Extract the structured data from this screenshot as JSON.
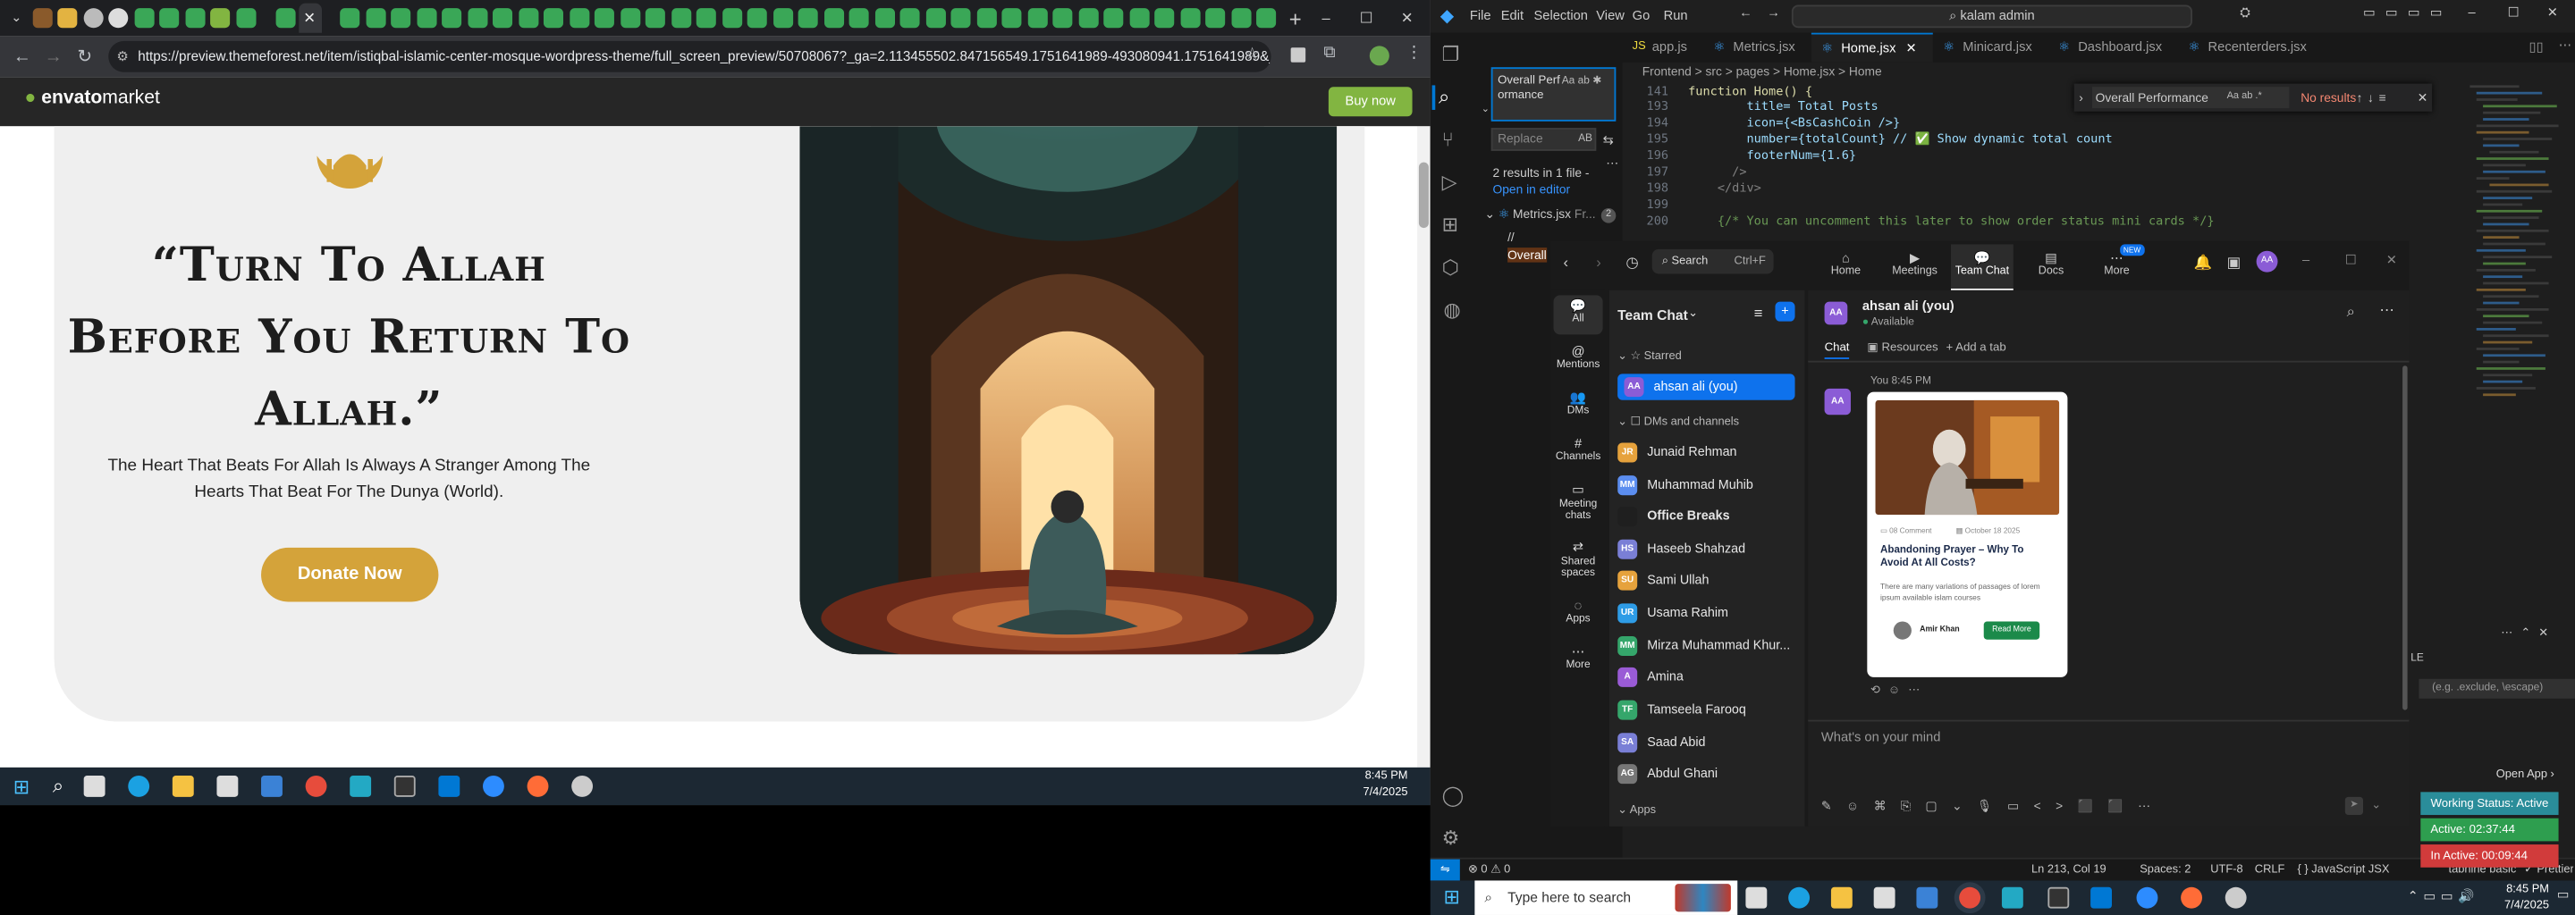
{
  "chrome": {
    "url": "https://preview.themeforest.net/item/istiqbal-islamic-center-mosque-wordpress-theme/full_screen_preview/50708067?_ga=2.113455502.847156549.1751641989-493080941.1751641989&_gac=1.6...",
    "url_host": "preview.themeforest.net",
    "new_tab": "+",
    "window_controls": {
      "minimize": "–",
      "maximize": "☐",
      "close": "✕"
    }
  },
  "envato": {
    "logo": "envato",
    "logo_suffix": "market",
    "buy_now": "Buy now"
  },
  "hero": {
    "quote": "“Turn To Allah Before You Return To Allah.”",
    "subtitle": "The Heart That Beats For Allah Is Always A Stranger Among The Hearts That Beat For The Dunya (World).",
    "donate": "Donate Now"
  },
  "taskbar_left": {
    "time": "8:45 PM",
    "date": "7/4/2025"
  },
  "vscode": {
    "menu": [
      "File",
      "Edit",
      "Selection",
      "View",
      "Go",
      "Run"
    ],
    "search_box": "kalam admin",
    "search": {
      "query": "Overall Performance",
      "replace": "Replace",
      "replace_all": "AB",
      "results": "2 results in 1 file -",
      "open_in_editor": "Open in editor",
      "file": "Metrics.jsx",
      "file_path": "Fr...",
      "file_count": "2",
      "match1": "//",
      "match2": "Overall"
    },
    "tabs": [
      "app.js",
      "Metrics.jsx",
      "Home.jsx",
      "Minicard.jsx",
      "Dashboard.jsx",
      "Recenterders.jsx"
    ],
    "active_tab": "Home.jsx",
    "breadcrumb": "Frontend  >  src  >  pages  >  Home.jsx  >  Home",
    "find": {
      "query": "Overall Performance",
      "result": "No results",
      "options": "Aa ab .*"
    },
    "code": [
      {
        "n": "193",
        "t": "        title= Total Posts"
      },
      {
        "n": "194",
        "t": "        icon={<BsCashCoin />}"
      },
      {
        "n": "195",
        "t": "        number={totalCount} // ✅ Show dynamic total count"
      },
      {
        "n": "196",
        "t": "        footerNum={1.6}"
      },
      {
        "n": "197",
        "t": "      />"
      },
      {
        "n": "198",
        "t": "    </div>"
      },
      {
        "n": "199",
        "t": ""
      },
      {
        "n": "200",
        "t": "    {/* You can uncomment this later to show order status mini cards */}"
      }
    ],
    "sticky_line": {
      "n": "141",
      "t": "function Home() {"
    },
    "status": {
      "errors": "⊗ 0  ⚠ 0",
      "position": "Ln 213, Col 19",
      "spaces": "Spaces: 2",
      "encoding": "UTF-8",
      "eol": "CRLF",
      "lang": "{ } JavaScript JSX",
      "tabnine": "tabnine basic",
      "prettier": "✓ Prettier"
    },
    "panel_hint": "LE",
    "panel_input": "(e.g. .exclude, \\escape)"
  },
  "zoom": {
    "search": "Search",
    "shortcut": "Ctrl+F",
    "nav": [
      "Home",
      "Meetings",
      "Team Chat",
      "Docs",
      "More"
    ],
    "new_badge": "NEW",
    "rail": [
      "All",
      "Mentions",
      "DMs",
      "Channels",
      "Meeting chats",
      "Shared spaces",
      "Apps",
      "More"
    ],
    "list_title": "Team Chat",
    "starred": "Starred",
    "self": "ahsan ali (you)",
    "dms_header": "DMs and channels",
    "contacts": [
      {
        "name": "Junaid Rehman",
        "initials": "JR",
        "color": "#e6a23c"
      },
      {
        "name": "Muhammad Muhib",
        "initials": "MM",
        "color": "#5b8def"
      },
      {
        "name": "Office Breaks",
        "initials": "",
        "color": "#1f1f1f"
      },
      {
        "name": "Haseeb Shahzad",
        "initials": "HS",
        "color": "#7a7fd6"
      },
      {
        "name": "Sami Ullah",
        "initials": "SU",
        "color": "#e6a23c"
      },
      {
        "name": "Usama Rahim",
        "initials": "UR",
        "color": "#2e9ce6"
      },
      {
        "name": "Mirza Muhammad Khur...",
        "initials": "MM",
        "color": "#35a66b"
      },
      {
        "name": "Amina",
        "initials": "A",
        "color": "#9a5bd6"
      },
      {
        "name": "Tamseela Farooq",
        "initials": "TF",
        "color": "#35a66b"
      },
      {
        "name": "Saad Abid",
        "initials": "SA",
        "color": "#7a7fd6"
      },
      {
        "name": "Abdul Ghani",
        "initials": "AG",
        "color": "#777777"
      }
    ],
    "apps": "Apps",
    "chat_user": "ahsan ali (you)",
    "chat_status": "Available",
    "chat_tabs": [
      "Chat",
      "Resources",
      "+ Add a tab"
    ],
    "msg_meta": "You 8:45 PM",
    "msg_avatar": "AA",
    "card": {
      "meta1": "08 Comment",
      "meta2": "October 18 2025",
      "title": "Abandoning Prayer – Why To Avoid At All Costs?",
      "body": "There are many variations of passages of lorem ipsum available islam courses",
      "author": "Amir Khan",
      "read_more": "Read More"
    },
    "composer": "What's on your mind"
  },
  "right_widgets": {
    "open_app": "Open App ›",
    "working": "Working Status: Active",
    "active": "Active: 02:37:44",
    "inactive": "In Active: 00:09:44"
  },
  "taskbar_right": {
    "search": "Type here to search",
    "time": "8:45 PM",
    "date": "7/4/2025"
  }
}
